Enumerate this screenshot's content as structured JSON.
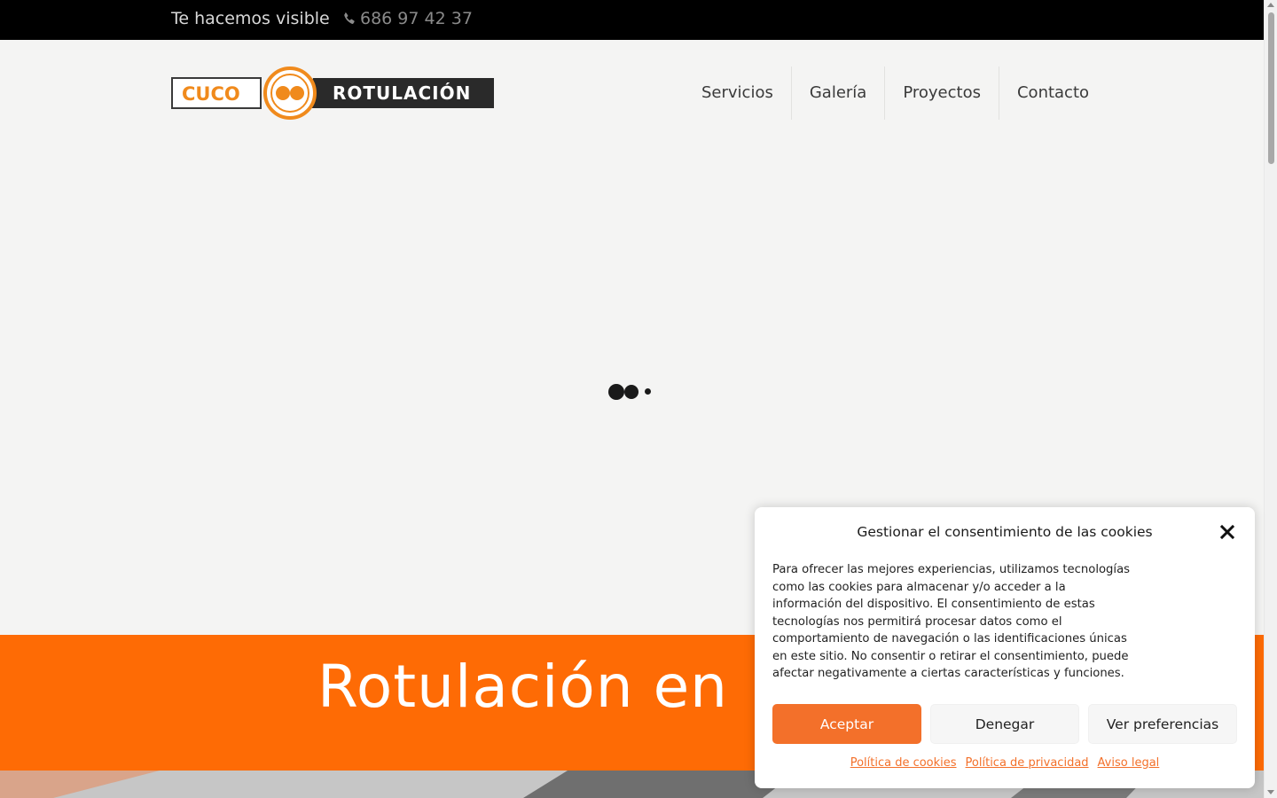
{
  "topbar": {
    "tagline": "Te hacemos visible",
    "phone": "686 97 42 37",
    "phone_icon": "phone-icon"
  },
  "logo": {
    "left_text": "CUCO",
    "right_text": "ROTULACIÓN",
    "accent_color": "#f08a1c"
  },
  "nav": {
    "items": [
      {
        "label": "Servicios"
      },
      {
        "label": "Galería"
      },
      {
        "label": "Proyectos"
      },
      {
        "label": "Contacto"
      }
    ]
  },
  "hero": {
    "heading": "Rotulación en",
    "band_color": "#fe6b05"
  },
  "cookie": {
    "title": "Gestionar el consentimiento de las cookies",
    "body": "Para ofrecer las mejores experiencias, utilizamos tecnologías como las cookies para almacenar y/o acceder a la información del dispositivo. El consentimiento de estas tecnologías nos permitirá procesar datos como el comportamiento de navegación o las identificaciones únicas en este sitio. No consentir o retirar el consentimiento, puede afectar negativamente a ciertas características y funciones.",
    "accept_label": "Aceptar",
    "deny_label": "Denegar",
    "prefs_label": "Ver preferencias",
    "links": [
      {
        "label": "Política de cookies"
      },
      {
        "label": "Política de privacidad"
      },
      {
        "label": "Aviso legal"
      }
    ],
    "accent_color": "#f3702a"
  }
}
